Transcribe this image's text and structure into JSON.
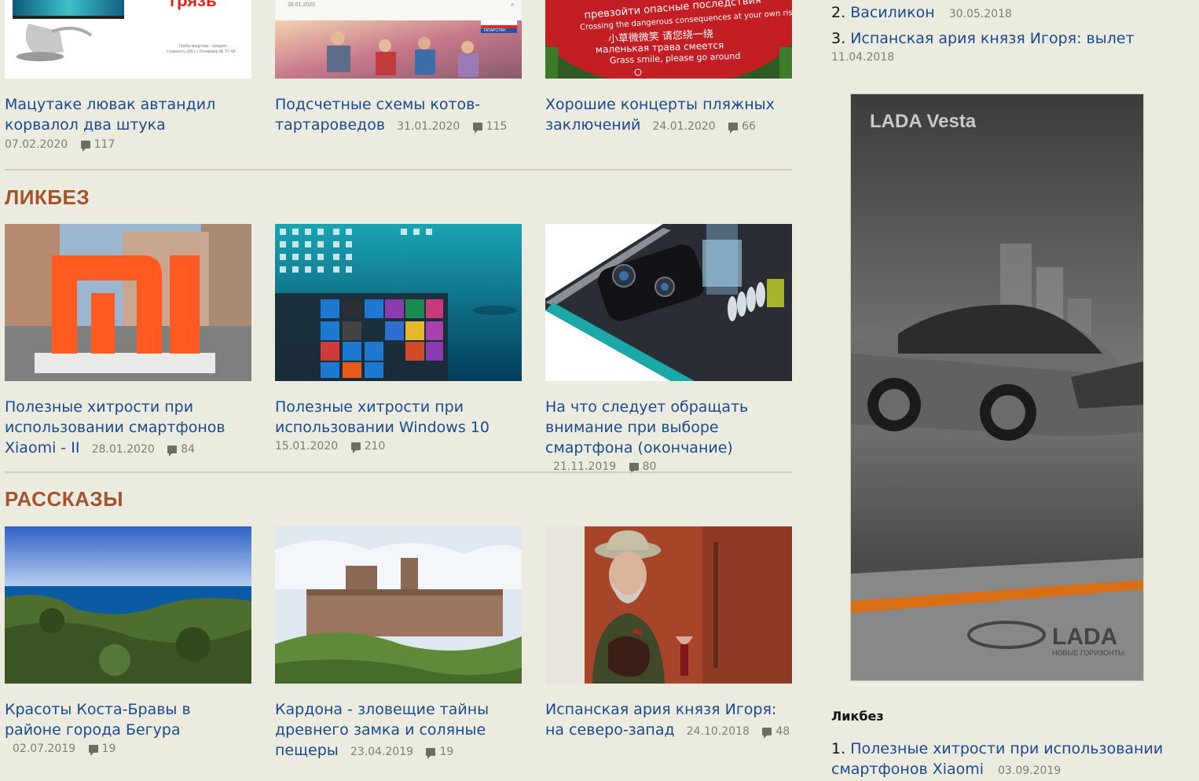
{
  "top_row": [
    {
      "title": "Мацутаке лювак автандил корвалол два штука",
      "date": "07.02.2020",
      "comments": "117",
      "thumb_text": "грязь",
      "thumb_caption": "Грибы мацутаке - средняя стоимость 200 г • Телевизор Mi TV 4A"
    },
    {
      "title": "Подсчетные схемы котов-тартароведов",
      "date": "31.01.2020",
      "comments": "115",
      "thumb_date": "28.01.2020",
      "thumb_badge": "РОССИЯ 1 ТАТАРСТАН"
    },
    {
      "title": "Хорошие концерты пляжных заключений",
      "date": "24.01.2020",
      "comments": "66",
      "sign_lines": [
        "превзойти опасные последствия",
        "Crossing the dangerous consequences at your own risk",
        "小草微微笑 请您绕一绕",
        "маленькая трава смеется",
        "Grass smile, please go around"
      ]
    }
  ],
  "sections": [
    {
      "title": "ЛИКБЕЗ",
      "cards": [
        {
          "title": "Полезные хитрости при использовании смартфонов Xiaomi - II",
          "date": "28.01.2020",
          "comments": "84"
        },
        {
          "title": "Полезные хитрости при использовании Windows 10",
          "date": "15.01.2020",
          "comments": "210"
        },
        {
          "title": "На что следует обращать внимание при выборе смартфона (окончание)",
          "date": "21.11.2019",
          "comments": "80"
        }
      ]
    },
    {
      "title": "РАССКАЗЫ",
      "cards": [
        {
          "title": "Красоты Коста-Бравы в районе города Бегура",
          "date": "02.07.2019",
          "comments": "19"
        },
        {
          "title": "Кардона - зловещие тайны древнего замка и соляные пещеры",
          "date": "23.04.2019",
          "comments": "19"
        },
        {
          "title": "Испанская ария князя Игоря: на северо-запад",
          "date": "24.10.2018",
          "comments": "48"
        }
      ]
    }
  ],
  "sidebar": {
    "top_list": [
      {
        "num": "2.",
        "title": "Василикон",
        "date": "30.05.2018"
      },
      {
        "num": "3.",
        "title": "Испанская ария князя Игоря: вылет",
        "date": "11.04.2018"
      }
    ],
    "ad": {
      "headline": "LADA Vesta",
      "brand": "LADA",
      "tagline": "НОВЫЕ ГОРИЗОНТЫ"
    },
    "likbez_heading": "Ликбез",
    "likbez_list": [
      {
        "num": "1.",
        "title": "Полезные хитрости при использовании смартфонов Xiaomi",
        "date": "03.09.2019"
      }
    ]
  },
  "colors": {
    "background": "#ecebe0",
    "link": "#1a4a8f",
    "section_title": "#a4532a",
    "meta": "#7d7d72"
  }
}
